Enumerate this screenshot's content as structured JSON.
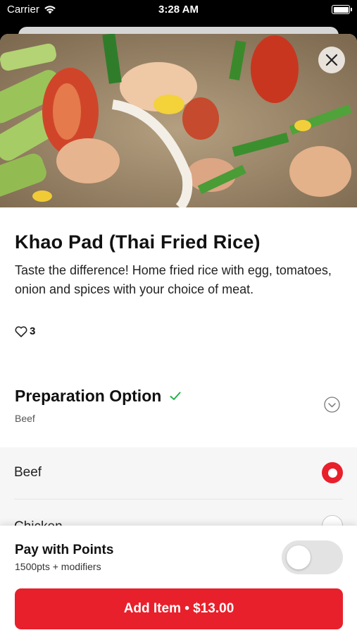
{
  "status_bar": {
    "carrier": "Carrier",
    "time": "3:28 AM"
  },
  "hero": {
    "image": "fried-rice-photo",
    "close_icon": "close-icon"
  },
  "item": {
    "title": "Khao Pad (Thai Fried Rice)",
    "description": "Taste the difference! Home fried rice with egg, tomatoes, onion and spices with your choice of meat.",
    "likes": "3"
  },
  "preparation": {
    "title": "Preparation Option",
    "selected": "Beef",
    "options": [
      {
        "label": "Beef",
        "selected": true
      },
      {
        "label": "Chicken",
        "selected": false
      }
    ]
  },
  "footer": {
    "pay_title": "Pay with Points",
    "pay_sub": "1500pts + modifiers",
    "pay_toggle_on": false,
    "add_button": "Add Item • $13.00"
  },
  "colors": {
    "accent": "#e8202b",
    "check": "#21b34a"
  }
}
